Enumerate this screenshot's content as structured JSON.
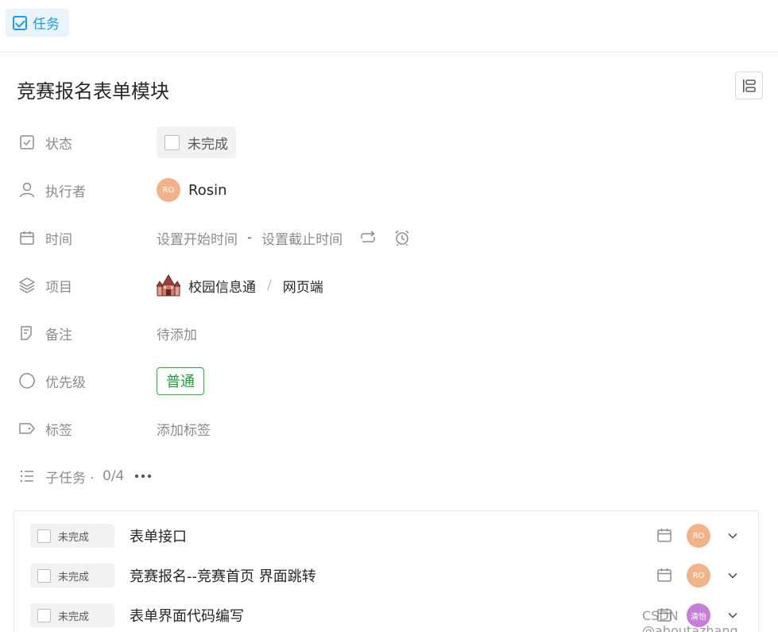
{
  "header": {
    "type_label": "任务"
  },
  "task": {
    "title": "竞赛报名表单模块",
    "fields": {
      "status": {
        "label": "状态",
        "value": "未完成"
      },
      "assignee": {
        "label": "执行者",
        "avatar_text": "RO",
        "name": "Rosin"
      },
      "time": {
        "label": "时间",
        "start_placeholder": "设置开始时间",
        "separator": "-",
        "end_placeholder": "设置截止时间"
      },
      "project": {
        "label": "项目",
        "project_name": "校园信息通",
        "separator": "/",
        "list_name": "网页端"
      },
      "note": {
        "label": "备注",
        "value": "待添加"
      },
      "priority": {
        "label": "优先级",
        "value": "普通"
      },
      "tags": {
        "label": "标签",
        "value": "添加标签"
      }
    },
    "subtasks": {
      "label": "子任务 ·",
      "count": "0/4",
      "items": [
        {
          "status": "未完成",
          "title": "表单接口",
          "avatar_text": "RO"
        },
        {
          "status": "未完成",
          "title": "竞赛报名--竞赛首页 界面跳转",
          "avatar_text": "RO"
        },
        {
          "status": "未完成",
          "title": "表单界面代码编写",
          "avatar_text": "清怡"
        }
      ]
    }
  },
  "colors": {
    "accent": "#1b9aee",
    "priority_green": "#2bb33f",
    "avatar_orange": "#f3b389",
    "avatar_purple": "#c57fd6"
  },
  "watermark": "CSDN @aboutazhang"
}
